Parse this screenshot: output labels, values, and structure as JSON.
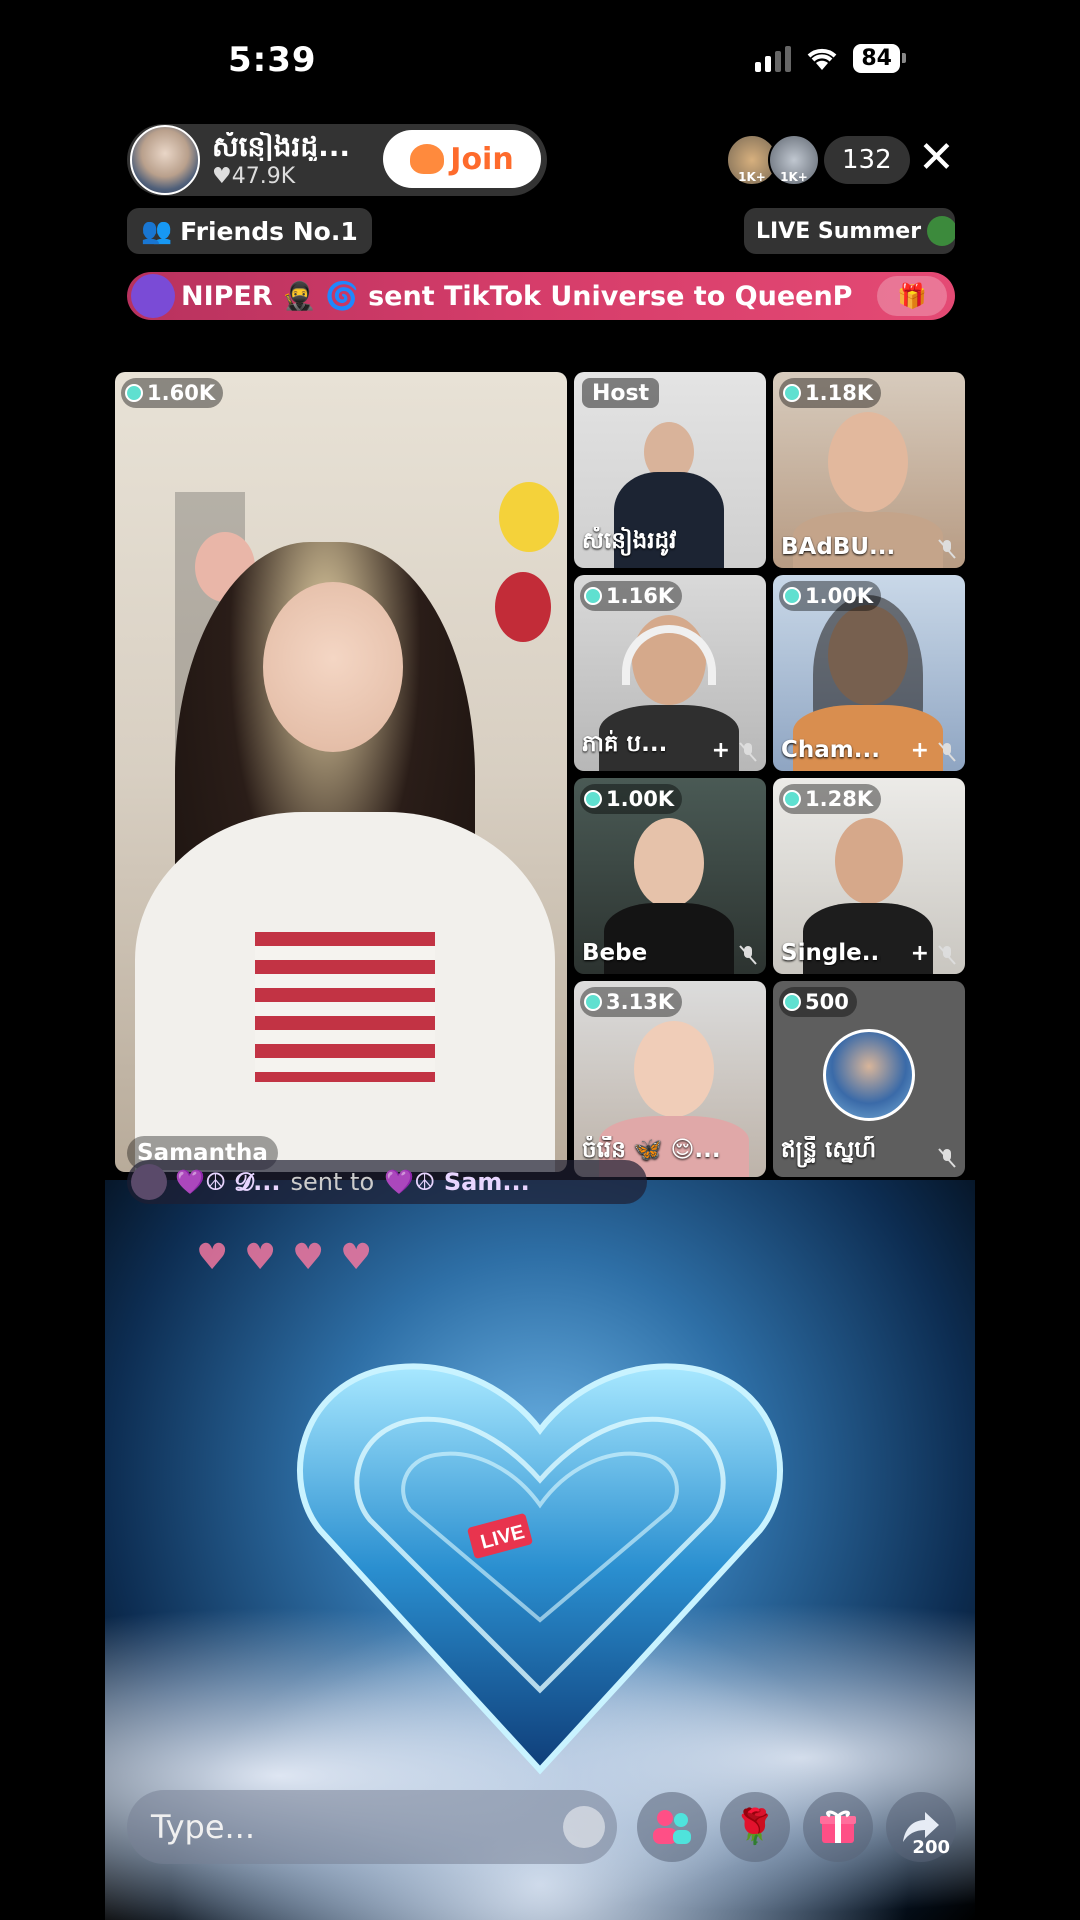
{
  "status_bar": {
    "time": "5:39",
    "battery": "84"
  },
  "host": {
    "name": "សំនៀងរដូ...",
    "likes": "♥47.9K",
    "join_label": "Join"
  },
  "viewers": {
    "count": "132",
    "avatar_badges": [
      "1K+",
      "1K+"
    ]
  },
  "friends_label": "Friends No.1",
  "live_pill_label": "LIVE Summer",
  "banner": {
    "text": "NIPER 🥷 🌀 sent TikTok Universe to QueenP"
  },
  "guests": [
    {
      "id": "main",
      "count": "1.60K",
      "name": "Samantha"
    },
    {
      "id": "host",
      "tag": "Host",
      "name": "សំនៀងរដូវ"
    },
    {
      "id": "g2",
      "count": "1.18K",
      "name": "BAdBU..."
    },
    {
      "id": "g3",
      "count": "1.16K",
      "name": "ភាគ់ ប..."
    },
    {
      "id": "g4",
      "count": "1.00K",
      "name": "Cham..."
    },
    {
      "id": "g5",
      "count": "1.00K",
      "name": "Bebe"
    },
    {
      "id": "g6",
      "count": "1.28K",
      "name": "Single..."
    },
    {
      "id": "g7",
      "count": "3.13K",
      "name": "ចំរើន 🦋 😌..."
    },
    {
      "id": "g8",
      "count": "500",
      "name": "ឥន្ទ្រី ស្នេហ៍"
    }
  ],
  "gift_row": {
    "sender": "💜☮ 𝓓...",
    "sent_to": "sent to",
    "recipient": "💜☮ Sam..."
  },
  "chat": {
    "placeholder": "Type..."
  },
  "share_count": "200"
}
